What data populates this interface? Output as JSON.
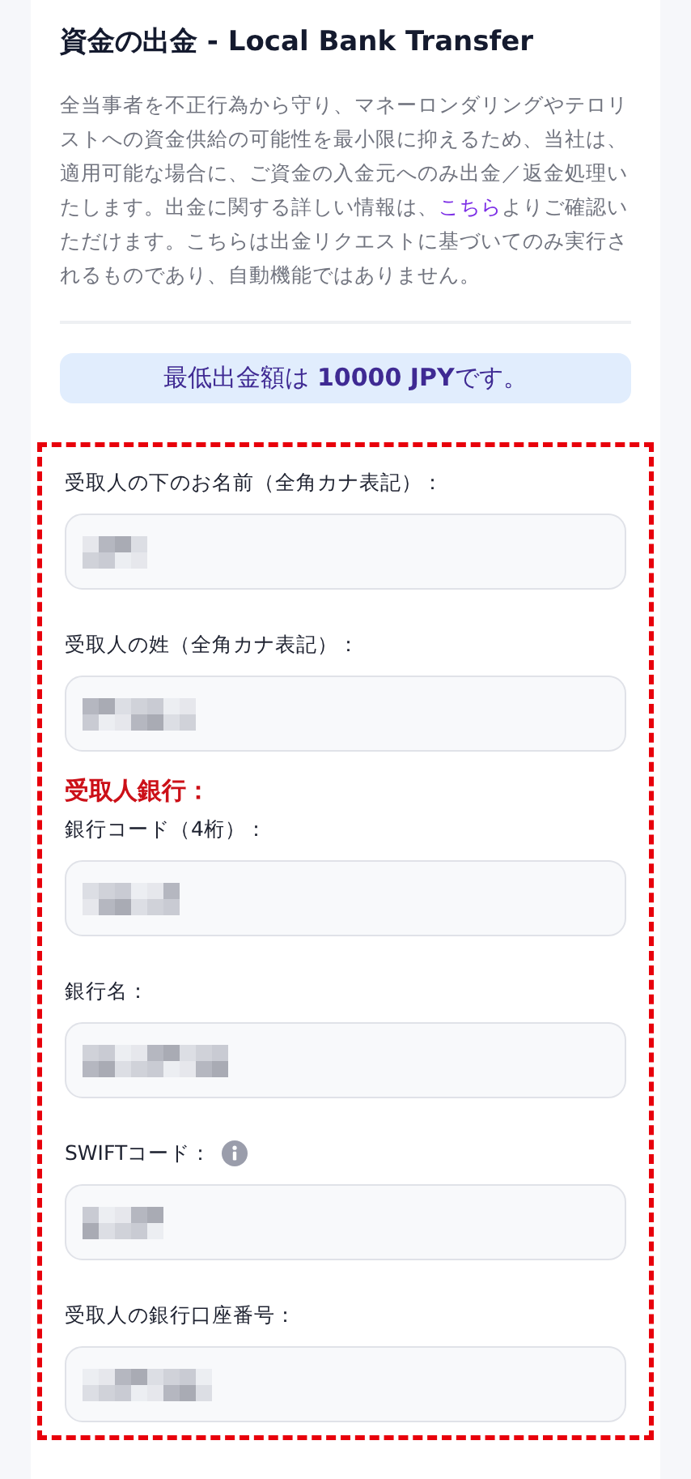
{
  "title": "資金の出金 - Local Bank Transfer",
  "description": {
    "before": "全当事者を不正行為から守り、マネーロンダリングやテロリストへの資金供給の可能性を最小限に抑えるため、当社は、適用可能な場合に、ご資金の入金元へのみ出金／返金処理いたします。出金に関する詳しい情報は、",
    "link": "こちら",
    "after": "よりご確認いただけます。こちらは出金リクエストに基づいてのみ実行されるものであり、自動機能ではありません。"
  },
  "notice": "最低出金額は **10000 JPY**です。",
  "form": {
    "highlighted": true,
    "items": [
      {
        "kind": "field",
        "label": "受取人の下のお名前（全角カナ表記）：",
        "redacted": true
      },
      {
        "kind": "field",
        "label": "受取人の姓（全角カナ表記）：",
        "redacted": true
      },
      {
        "kind": "heading",
        "label": "受取人銀行："
      },
      {
        "kind": "field",
        "label": "銀行コード（4桁）：",
        "redacted": true
      },
      {
        "kind": "field",
        "label": "銀行名：",
        "redacted": true
      },
      {
        "kind": "field",
        "label": "SWIFTコード：",
        "redacted": true,
        "info": true
      },
      {
        "kind": "field",
        "label": "受取人の銀行口座番号：",
        "redacted": true
      }
    ]
  }
}
